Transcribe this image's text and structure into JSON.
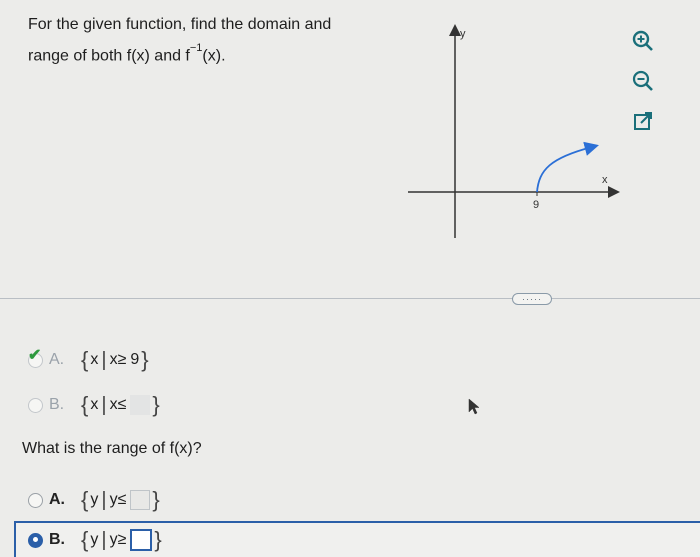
{
  "question": {
    "line1": "For the given function, find the domain and",
    "line2_pre": "range of both f(x) and f",
    "line2_sup": "−1",
    "line2_post": "(x)."
  },
  "graph": {
    "y_label": "y",
    "x_label": "x",
    "x_tick": "9",
    "curve_color": "#2b6fd6"
  },
  "tools": {
    "zoom_in": "zoom-in-icon",
    "zoom_out": "zoom-out-icon",
    "popout": "external-link-icon"
  },
  "more_button": "·····",
  "domain_options": [
    {
      "letter": "A.",
      "var": "x",
      "rel": "x≥",
      "value": "9"
    },
    {
      "letter": "B.",
      "var": "x",
      "rel": "x≤",
      "value": ""
    }
  ],
  "subquestion": "What is the range of f(x)?",
  "range_options": [
    {
      "letter": "A.",
      "var": "y",
      "rel": "y≤",
      "value": ""
    },
    {
      "letter": "B.",
      "var": "y",
      "rel": "y≥",
      "value": ""
    }
  ],
  "colors": {
    "accent": "#2b5fa8",
    "correct": "#2e9a3e",
    "teal_icon": "#1a6f7a"
  }
}
